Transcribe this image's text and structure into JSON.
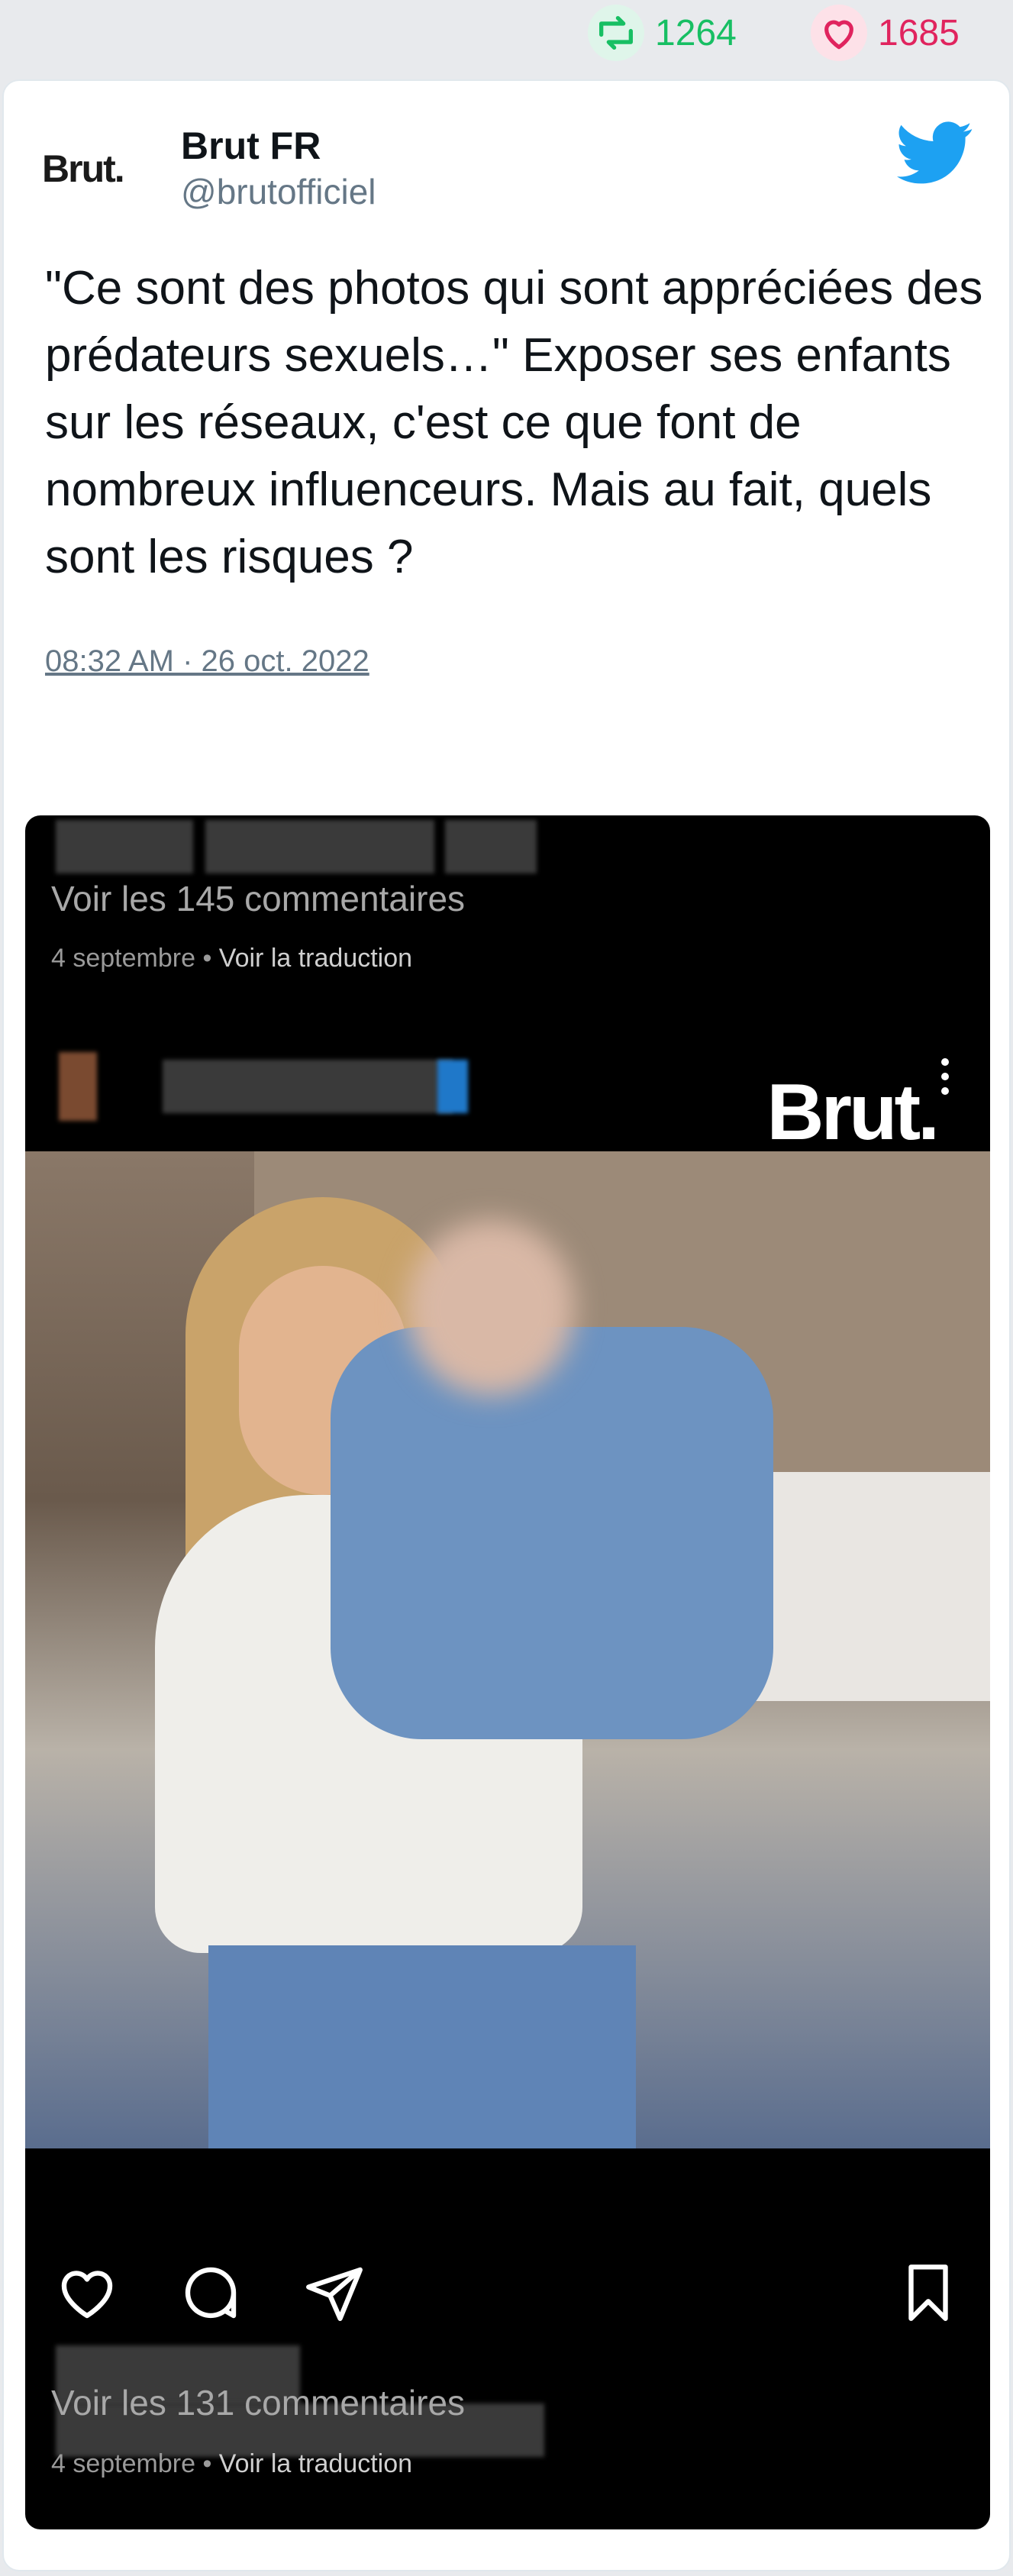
{
  "stats": {
    "retweets": "1264",
    "likes": "1685",
    "retweet_color": "#17bf63",
    "like_color": "#e0245e"
  },
  "tweet": {
    "avatar_text": "Brut.",
    "author_name": "Brut FR",
    "author_handle": "@brutofficiel",
    "text": "\"Ce sont des photos qui sont appréciées des prédateurs sexuels…\" Exposer ses enfants sur les réseaux, c'est ce que font de nombreux influenceurs. Mais au fait, quels sont les risques ?",
    "timestamp": "08:32 AM · 26 oct. 2022",
    "icons": [
      "reply-icon",
      "retweet-icon",
      "like-icon",
      "twitter-bird-icon"
    ],
    "brand_color": "#1da1f2"
  },
  "media": {
    "top_comments_link": "Voir les 145 commentaires",
    "top_date": "4 septembre",
    "top_translate": "Voir la traduction",
    "watermark": "Brut.",
    "bottom_comments_link": "Voir les 131 commentaires",
    "bottom_date": "4 septembre",
    "bottom_translate": "Voir la traduction",
    "icons": [
      "heart-icon",
      "comment-icon",
      "send-icon",
      "bookmark-icon",
      "more-icon"
    ]
  }
}
